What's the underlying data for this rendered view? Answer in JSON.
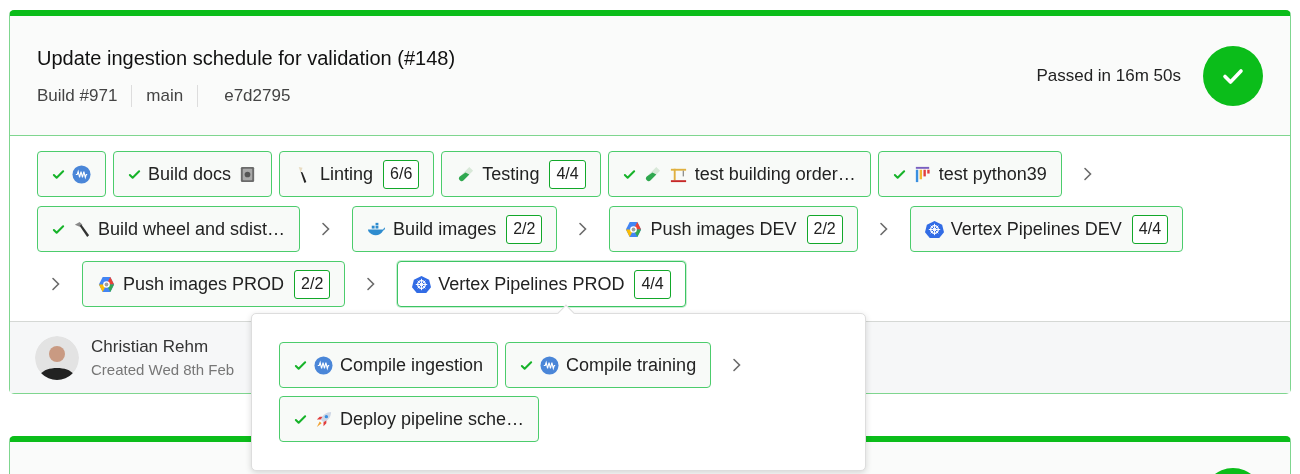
{
  "build": {
    "title": "Update ingestion schedule for validation (#148)",
    "meta": [
      "Build #971",
      "main",
      "e7d2795"
    ],
    "status_text": "Passed in 16m 50s",
    "passed": true,
    "pipeline_rows": [
      [
        {
          "kind": "step",
          "passed": true,
          "icons": [
            {
              "kind": "wave"
            }
          ]
        },
        {
          "kind": "step",
          "passed": true,
          "label": "Build docs",
          "icons_after": [
            {
              "kind": "book"
            }
          ]
        },
        {
          "kind": "step",
          "passed": false,
          "icons": [
            {
              "kind": "brush"
            }
          ],
          "label": "Linting",
          "count": "6/6"
        },
        {
          "kind": "step",
          "passed": false,
          "icons": [
            {
              "kind": "tube"
            }
          ],
          "label": "Testing",
          "count": "4/4"
        },
        {
          "kind": "step",
          "passed": true,
          "icons": [
            {
              "kind": "tube"
            },
            {
              "kind": "crane"
            }
          ],
          "label": "test building order…"
        },
        {
          "kind": "step",
          "passed": true,
          "icons": [
            {
              "kind": "bars"
            }
          ],
          "label": "test python39"
        },
        {
          "kind": "chevron"
        }
      ],
      [
        {
          "kind": "step",
          "passed": true,
          "icons": [
            {
              "kind": "hammer"
            }
          ],
          "label": "Build wheel and sdist…"
        },
        {
          "kind": "chevron"
        },
        {
          "kind": "step",
          "passed": false,
          "icons": [
            {
              "kind": "whale"
            }
          ],
          "label": "Build images",
          "count": "2/2"
        },
        {
          "kind": "chevron"
        },
        {
          "kind": "step",
          "passed": false,
          "icons": [
            {
              "kind": "hexagon"
            }
          ],
          "label": "Push images DEV",
          "count": "2/2"
        },
        {
          "kind": "chevron"
        },
        {
          "kind": "step",
          "passed": false,
          "icons": [
            {
              "kind": "helm"
            }
          ],
          "label": "Vertex Pipelines DEV",
          "count": "4/4"
        }
      ],
      [
        {
          "kind": "chevron"
        },
        {
          "kind": "step",
          "passed": false,
          "icons": [
            {
              "kind": "hexagon"
            }
          ],
          "label": "Push images PROD",
          "count": "2/2"
        },
        {
          "kind": "chevron"
        },
        {
          "kind": "step",
          "passed": false,
          "icons": [
            {
              "kind": "helm"
            }
          ],
          "label": "Vertex Pipelines PROD",
          "count": "4/4",
          "expanded": true
        }
      ]
    ],
    "author": {
      "name": "Christian Rehm",
      "created": "Created Wed 8th Feb"
    },
    "popover_rows": [
      [
        {
          "kind": "step",
          "passed": true,
          "icons": [
            {
              "kind": "wave"
            }
          ],
          "label": "Compile ingestion"
        },
        {
          "kind": "step",
          "passed": true,
          "icons": [
            {
              "kind": "wave"
            }
          ],
          "label": "Compile training"
        },
        {
          "kind": "chevron"
        }
      ],
      [
        {
          "kind": "step",
          "passed": true,
          "icons": [
            {
              "kind": "rocket"
            }
          ],
          "label": "Deploy pipeline sche…"
        }
      ]
    ]
  },
  "next_build": {
    "passed": true
  }
}
